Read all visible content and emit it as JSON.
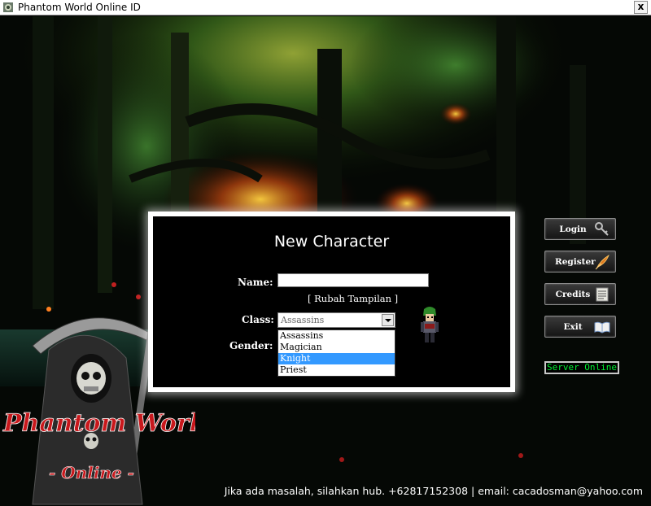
{
  "window": {
    "title": "Phantom World Online ID",
    "close_label": "x"
  },
  "dialog": {
    "title": "New Character",
    "name_label": "Name:",
    "name_value": "",
    "change_look_link": "[ Rubah Tampilan ]",
    "class_label": "Class:",
    "class_selected": "Assassins",
    "class_options": [
      "Assassins",
      "Magician",
      "Knight",
      "Priest"
    ],
    "class_highlighted": "Knight",
    "gender_label": "Gender:"
  },
  "side_buttons": [
    {
      "label": "Login",
      "icon": "key-icon"
    },
    {
      "label": "Register",
      "icon": "feather-quill-icon"
    },
    {
      "label": "Credits",
      "icon": "scroll-icon"
    },
    {
      "label": "Exit",
      "icon": "book-icon"
    }
  ],
  "server_status": {
    "text": "Server Online",
    "color": "#00ee33"
  },
  "footer": {
    "text": "Jika ada masalah, silahkan hub. +62817152308 | email: cacadosman@yahoo.com"
  },
  "logo": {
    "line1": "Phantom World",
    "line2": "- Online -"
  },
  "colors": {
    "dialog_bg": "#000000",
    "dialog_border": "#ffffff",
    "selection": "#3399ff",
    "logo_red": "#c8181c"
  }
}
